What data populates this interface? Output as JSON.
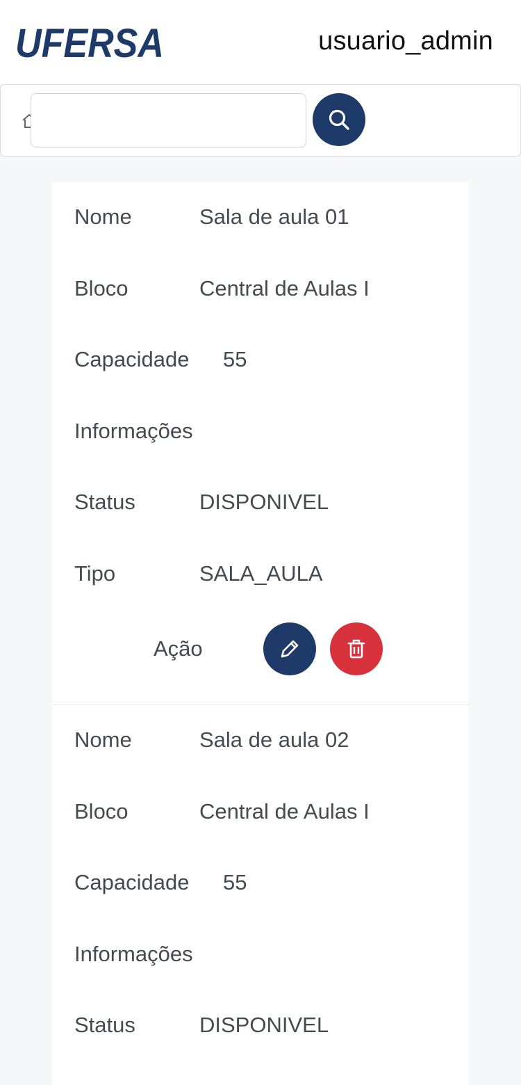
{
  "header": {
    "logo_text": "UFERSA",
    "username": "usuario_admin",
    "brand_color": "#1d3a68"
  },
  "search": {
    "placeholder": "",
    "value": ""
  },
  "records": [
    {
      "fields": [
        {
          "label": "Nome",
          "value": "Sala de aula 01"
        },
        {
          "label": "Bloco",
          "value": "Central de Aulas I"
        },
        {
          "label": "Capacidade",
          "value": "55"
        },
        {
          "label": "Informações",
          "value": ""
        },
        {
          "label": "Status",
          "value": "DISPONIVEL"
        },
        {
          "label": "Tipo",
          "value": "SALA_AULA"
        }
      ],
      "action_label": "Ação"
    },
    {
      "fields": [
        {
          "label": "Nome",
          "value": "Sala de aula 02"
        },
        {
          "label": "Bloco",
          "value": "Central de Aulas I"
        },
        {
          "label": "Capacidade",
          "value": "55"
        },
        {
          "label": "Informações",
          "value": ""
        },
        {
          "label": "Status",
          "value": "DISPONIVEL"
        }
      ]
    }
  ],
  "colors": {
    "edit": "#1d3a68",
    "delete": "#d7313b"
  }
}
